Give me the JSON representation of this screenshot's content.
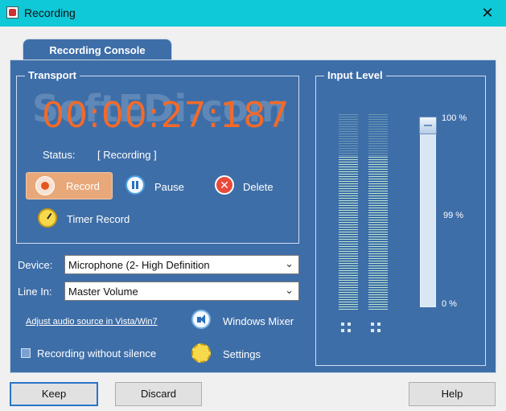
{
  "window": {
    "title": "Recording",
    "close_glyph": "✕"
  },
  "console_tab": "Recording Console",
  "transport": {
    "legend": "Transport",
    "timer": "00:00:27:187",
    "watermark": "SoftEDi.com",
    "status_label": "Status:",
    "status_value": "[ Recording ]",
    "record_label": "Record",
    "pause_label": "Pause",
    "delete_label": "Delete",
    "timer_record_label": "Timer Record"
  },
  "device": {
    "label": "Device:",
    "value": "Microphone (2- High Definition"
  },
  "line_in": {
    "label": "Line In:",
    "value": "Master Volume"
  },
  "adjust_link": "Adjust audio source in Vista/Win7",
  "windows_mixer_label": "Windows Mixer",
  "recording_without_silence_label": "Recording without silence",
  "recording_without_silence_checked": false,
  "settings_label": "Settings",
  "input_level": {
    "legend": "Input Level",
    "tick_top": "100 %",
    "tick_mid": "99 %",
    "tick_bottom": "0 %",
    "left_meter_fraction": 0.78,
    "right_meter_fraction": 0.78,
    "volume_fraction": 1.0
  },
  "buttons": {
    "keep": "Keep",
    "discard": "Discard",
    "help": "Help"
  },
  "colors": {
    "title_bar": "#0fc8d8",
    "panel": "#3e6ea8",
    "timer": "#f26a2a",
    "record_button": "#e8a87a"
  },
  "icons": {
    "record": "record-dot-icon",
    "pause": "pause-icon",
    "delete": "delete-x-icon",
    "timer_record": "stopwatch-icon",
    "windows_mixer": "speaker-icon",
    "settings": "gear-icon"
  }
}
